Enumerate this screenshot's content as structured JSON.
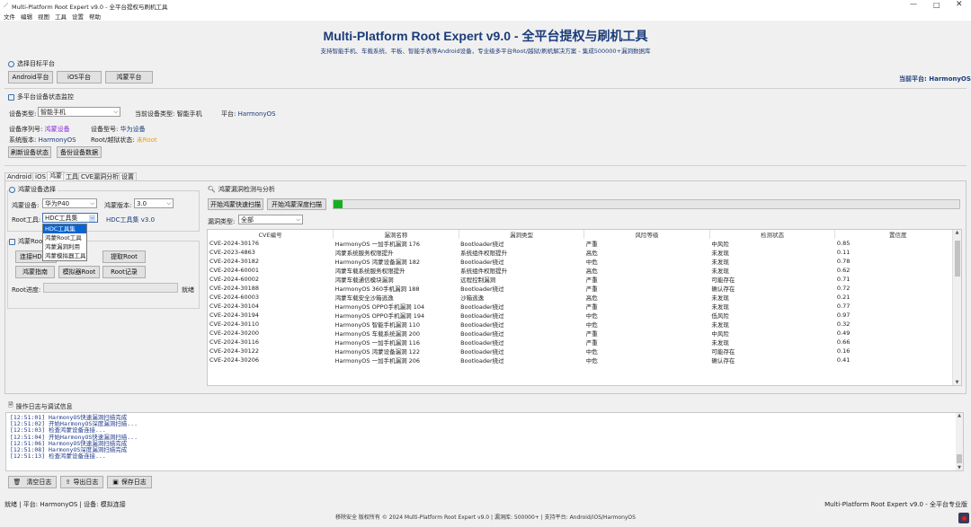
{
  "window": {
    "title": "Multi-Platform Root Expert v9.0 - 全平台提权与刷机工具"
  },
  "menu": [
    "文件",
    "编辑",
    "视图",
    "工具",
    "设置",
    "帮助"
  ],
  "header": {
    "title": "Multi-Platform Root Expert v9.0 - 全平台提权与刷机工具",
    "subtitle": "支持智能手机、车载系统、平板、智能手表等Android设备，专业级多平台Root/越狱/刷机解决方案 - 集成500000+漏洞数据库"
  },
  "platform": {
    "group_title": "选择目标平台",
    "buttons": [
      "Android平台",
      "iOS平台",
      "鸿蒙平台"
    ],
    "current_label": "当前平台: HarmonyOS"
  },
  "monitor": {
    "group_title": "多平台设备状态监控",
    "device_type_label": "设备类型:",
    "device_type_value": "智能手机",
    "current_type": "当前设备类型: 智能手机",
    "platform_text": "平台: ",
    "platform_value": "HarmonyOS",
    "serial_label": "设备序列号: ",
    "serial_value": "鸿蒙设备",
    "model_label": "设备型号: ",
    "model_value": "华为设备",
    "sysver_label": "系统版本: ",
    "sysver_value": "HarmonyOS",
    "root_label": "Root/越狱状态: ",
    "root_value": "未Root",
    "refresh_btn": "刷新设备状态",
    "backup_btn": "备份设备数据"
  },
  "tabs": [
    "Android",
    "iOS",
    "鸿蒙",
    "工具",
    "CVE漏洞分析",
    "设置"
  ],
  "harmony_select": {
    "group_title": "鸿蒙设备选择",
    "device_label": "鸿蒙设备:",
    "device_value": "华为P40",
    "version_label": "鸿蒙版本:",
    "version_value": "3.0",
    "tool_label": "Root工具:",
    "tool_value": "HDC工具集",
    "tool_info": "HDC工具集 v3.0",
    "dropdown_options": [
      "HDC工具集",
      "鸿蒙Root工具",
      "鸿蒙漏洞利用",
      "鸿蒙模拟器工具"
    ]
  },
  "harmony_root": {
    "group_title": "鸿蒙Root",
    "btn_connect": "连接HDC",
    "btn_extract": "提取Root",
    "btn_guide": "鸿蒙指南",
    "btn_sim": "模拟器Root",
    "btn_log": "Root记录",
    "progress_label": "Root进度:",
    "progress_status": "就绪"
  },
  "vuln": {
    "group_title": "鸿蒙漏洞检测与分析",
    "btn_quick": "开始鸿蒙快速扫描",
    "btn_deep": "开始鸿蒙深度扫描",
    "progress": 0.015,
    "type_label": "漏洞类型:",
    "type_value": "全部",
    "columns": [
      "CVE编号",
      "漏洞名称",
      "漏洞类型",
      "风险等级",
      "检测状态",
      "置信度"
    ],
    "rows": [
      [
        "CVE-2024-30176",
        "HarmonyOS 一加手机漏洞 176",
        "Bootloader绕过",
        "严重",
        "中风险",
        "0.85"
      ],
      [
        "CVE-2023-4863",
        "鸿蒙系统服务权限提升",
        "系统组件权限提升",
        "高危",
        "未发现",
        "0.11"
      ],
      [
        "CVE-2024-30182",
        "HarmonyOS 鸿蒙设备漏洞 182",
        "Bootloader绕过",
        "中危",
        "未发现",
        "0.78"
      ],
      [
        "CVE-2024-60001",
        "鸿蒙车载系统服务权限提升",
        "系统组件权限提升",
        "高危",
        "未发现",
        "0.62"
      ],
      [
        "CVE-2024-60002",
        "鸿蒙车载通信模块漏洞",
        "远程控制漏洞",
        "严重",
        "可能存在",
        "0.71"
      ],
      [
        "CVE-2024-30188",
        "HarmonyOS 360手机漏洞 188",
        "Bootloader绕过",
        "严重",
        "确认存在",
        "0.72"
      ],
      [
        "CVE-2024-60003",
        "鸿蒙车载安全沙箱逃逸",
        "沙箱逃逸",
        "高危",
        "未发现",
        "0.21"
      ],
      [
        "CVE-2024-30104",
        "HarmonyOS OPPO手机漏洞 104",
        "Bootloader绕过",
        "严重",
        "未发现",
        "0.77"
      ],
      [
        "CVE-2024-30194",
        "HarmonyOS OPPO手机漏洞 194",
        "Bootloader绕过",
        "中危",
        "低风险",
        "0.97"
      ],
      [
        "CVE-2024-30110",
        "HarmonyOS 智能手机漏洞 110",
        "Bootloader绕过",
        "中危",
        "未发现",
        "0.32"
      ],
      [
        "CVE-2024-30200",
        "HarmonyOS 车载系统漏洞 200",
        "Bootloader绕过",
        "严重",
        "中风险",
        "0.49"
      ],
      [
        "CVE-2024-30116",
        "HarmonyOS 一加手机漏洞 116",
        "Bootloader绕过",
        "严重",
        "未发现",
        "0.66"
      ],
      [
        "CVE-2024-30122",
        "HarmonyOS 鸿蒙设备漏洞 122",
        "Bootloader绕过",
        "中危",
        "可能存在",
        "0.16"
      ],
      [
        "CVE-2024-30206",
        "HarmonyOS 一加手机漏洞 206",
        "Bootloader绕过",
        "中危",
        "确认存在",
        "0.41"
      ]
    ]
  },
  "logs": {
    "group_title": "操作日志与调试信息",
    "lines": [
      "[12:51:01] HarmonyOS快速漏洞扫描完成",
      "[12:51:02] 开始HarmonyOS深度漏洞扫描...",
      "[12:51:03] 检查鸿蒙设备连接...",
      "[12:51:04] 开始HarmonyOS快速漏洞扫描...",
      "[12:51:06] HarmonyOS快速漏洞扫描完成",
      "[12:51:08] HarmonyOS深度漏洞扫描完成",
      "[12:51:13] 检查鸿蒙设备连接..."
    ],
    "btn_clear": "清空日志",
    "btn_export": "导出日志",
    "btn_save": "保存日志"
  },
  "status": {
    "left": "就绪 | 平台: HarmonyOS | 设备: 模拟连接",
    "right": "Multi-Platform Root Expert v9.0 - 全平台专业版",
    "footer": "移除安全 版权所有 © 2024 Multi-Platform Root Expert v9.0 | 漏洞库: 500000+ | 支持平台: Android/iOS/HarmonyOS"
  },
  "colors": {
    "accent": "#1a3c7a",
    "purple": "#8a2be2",
    "orange": "#f0a000",
    "blue": "#2050c0",
    "green": "#12b020"
  }
}
